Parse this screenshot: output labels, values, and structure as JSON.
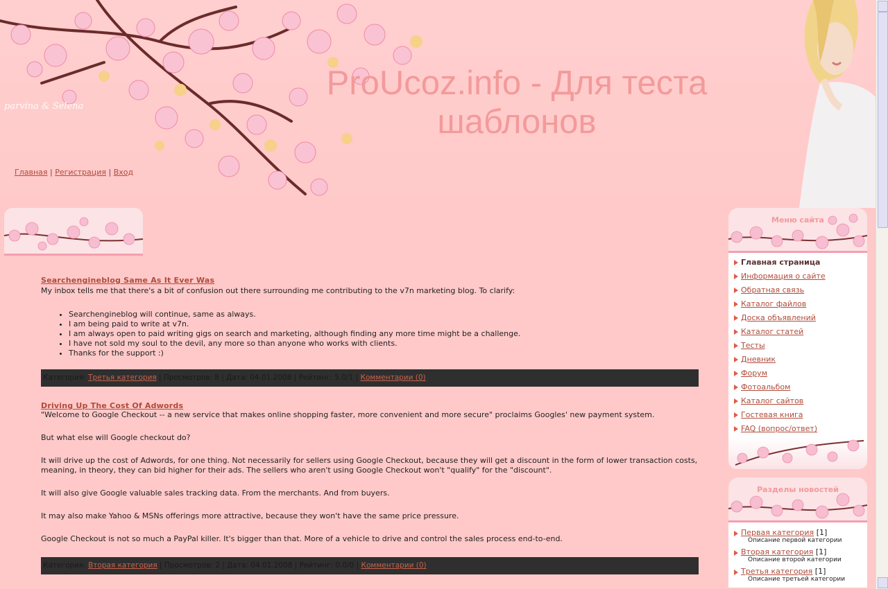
{
  "header": {
    "signature": "parvina & Selena",
    "site_title": "ProUcoz.info - Для теста шаблонов",
    "nav": [
      {
        "label": "Главная"
      },
      {
        "label": "Регистрация"
      },
      {
        "label": "Вход"
      }
    ],
    "nav_separator": "|"
  },
  "posts": [
    {
      "title": "Searchengineblog Same As It Ever Was",
      "intro": "My inbox tells me that there's a bit of confusion out there surrounding me contributing to the v7n marketing blog. To clarify:",
      "list": [
        "Searchengineblog will continue, same as always.",
        "I am being paid to write at v7n.",
        "I am always open to paid writing gigs on search and marketing, although finding any more time might be a challenge.",
        "I have not sold my soul to the devil, any more so than anyone who works with clients.",
        "Thanks for the support :)"
      ],
      "meta": {
        "category_label": "Категория:",
        "category": "Третья категория",
        "views": "| Просмотров: 8 | Дата: 04.01.2008 | Рейтинг: 5.0/1 |",
        "comments": "Комментарии (0)"
      }
    },
    {
      "title": "Driving Up The Cost Of Adwords",
      "paragraphs": [
        "\"Welcome to Google Checkout -- a new service that makes online shopping faster, more convenient and more secure\" proclaims Googles' new payment system.",
        "But what else will Google checkout do?",
        "It will drive up the cost of Adwords, for one thing. Not necessarily for sellers using Google Checkout, because they will get a discount in the form of lower transaction costs, meaning, in theory, they can bid higher for their ads. The sellers who aren't using Google Checkout won't \"qualify\" for the \"discount\".",
        "It will also give Google valuable sales tracking data. From the merchants. And from buyers.",
        "It may also make Yahoo & MSNs offerings more attractive, because they won't have the same price pressure.",
        "Google Checkout is not so much a PayPal killer. It's bigger than that. More of a vehicle to drive and control the sales process end-to-end."
      ],
      "meta": {
        "category_label": "Категория:",
        "category": "Вторая категория",
        "views": "| Просмотров: 2 | Дата: 04.01.2008 | Рейтинг: 0.0/0 |",
        "comments": "Комментарии (0)"
      }
    }
  ],
  "sidebar": {
    "menu_title": "Меню сайта",
    "menu": [
      {
        "label": "Главная страница",
        "current": true
      },
      {
        "label": "Информация о сайте"
      },
      {
        "label": "Обратная связь"
      },
      {
        "label": "Каталог файлов"
      },
      {
        "label": "Доска объявлений"
      },
      {
        "label": "Каталог статей"
      },
      {
        "label": "Тесты"
      },
      {
        "label": "Дневник"
      },
      {
        "label": "Форум"
      },
      {
        "label": "Фотоальбом"
      },
      {
        "label": "Каталог сайтов"
      },
      {
        "label": "Гостевая книга"
      },
      {
        "label": "FAQ (вопрос/ответ)"
      }
    ],
    "news_title": "Разделы новостей",
    "news_categories": [
      {
        "label": "Первая категория",
        "count": "[1]",
        "description": "Описание первой категории"
      },
      {
        "label": "Вторая категория",
        "count": "[1]",
        "description": "Описание второй категории"
      },
      {
        "label": "Третья категория",
        "count": "[1]",
        "description": "Описание третьей категории"
      }
    ]
  },
  "colors": {
    "background": "#ffc9c9",
    "title": "#f39a9a",
    "link": "#b04b3a",
    "meta_bar": "#2f2f2f"
  }
}
